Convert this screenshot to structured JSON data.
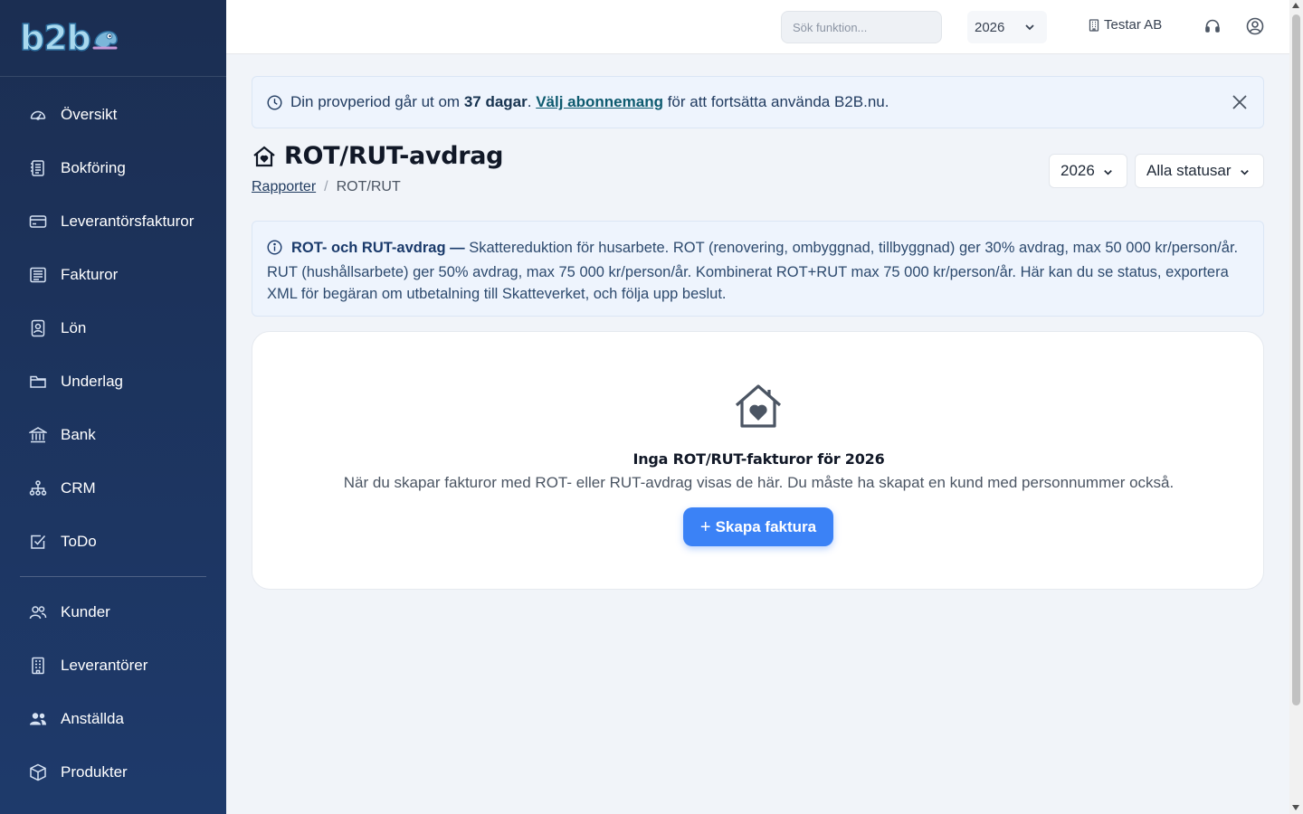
{
  "brand": {
    "logo_text": "b2b"
  },
  "sidebar": {
    "items": [
      {
        "label": "Översikt",
        "icon": "gauge-icon"
      },
      {
        "label": "Bokföring",
        "icon": "ledger-icon"
      },
      {
        "label": "Leverantörsfakturor",
        "icon": "credit-card-icon"
      },
      {
        "label": "Fakturor",
        "icon": "invoice-icon"
      },
      {
        "label": "Lön",
        "icon": "id-badge-icon"
      },
      {
        "label": "Underlag",
        "icon": "folder-icon"
      },
      {
        "label": "Bank",
        "icon": "bank-icon"
      },
      {
        "label": "CRM",
        "icon": "org-chart-icon"
      },
      {
        "label": "ToDo",
        "icon": "checkbox-icon"
      }
    ],
    "items2": [
      {
        "label": "Kunder",
        "icon": "users-icon"
      },
      {
        "label": "Leverantörer",
        "icon": "building-icon"
      },
      {
        "label": "Anställda",
        "icon": "people-icon"
      },
      {
        "label": "Produkter",
        "icon": "box-icon"
      }
    ]
  },
  "topbar": {
    "search_placeholder": "Sök funktion...",
    "year": "2026",
    "company": "Testar AB"
  },
  "trial": {
    "prefix": "Din provperiod går ut om ",
    "days": "37 dagar",
    "after_days": ". ",
    "link": "Välj abonnemang",
    "suffix": " för att fortsätta använda B2B.nu."
  },
  "page": {
    "title": "ROT/RUT-avdrag",
    "breadcrumb_parent": "Rapporter",
    "breadcrumb_sep": "/",
    "breadcrumb_current": "ROT/RUT",
    "year_filter": "2026",
    "status_filter": "Alla statusar"
  },
  "info": {
    "heading": "ROT- och RUT-avdrag —",
    "body": " Skattereduktion för husarbete. ROT (renovering, ombyggnad, tillbyggnad) ger 30% avdrag, max 50 000 kr/person/år. RUT (hushållsarbete) ger 50% avdrag, max 75 000 kr/person/år. Kombinerat ROT+RUT max 75 000 kr/person/år. Här kan du se status, exportera XML för begäran om utbetalning till Skatteverket, och följa upp beslut."
  },
  "empty": {
    "title": "Inga ROT/RUT-fakturor för 2026",
    "description": "När du skapar fakturor med ROT- eller RUT-avdrag visas de här. Du måste ha skapat en kund med personnummer också.",
    "button": "Skapa faktura",
    "button_icon": "plus-icon"
  },
  "colors": {
    "sidebar_top": "#1b2e52",
    "sidebar_bottom": "#1e3a6b",
    "accent": "#3b82f6",
    "banner_bg": "#eef4fd"
  }
}
